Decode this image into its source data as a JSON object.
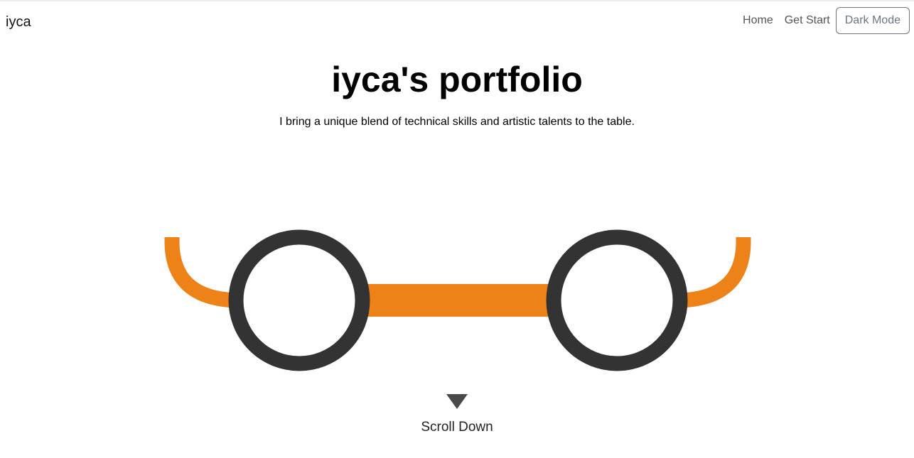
{
  "navbar": {
    "brand": "iyca",
    "links": [
      "Home",
      "Get Start"
    ],
    "dark_mode_label": "Dark Mode"
  },
  "hero": {
    "title": "iyca's portfolio",
    "subtitle": "I bring a unique blend of technical skills and artistic talents to the table."
  },
  "illustration": {
    "frame_color": "#333333",
    "accent_color": "#EC8218"
  },
  "scroll": {
    "label": "Scroll Down"
  }
}
